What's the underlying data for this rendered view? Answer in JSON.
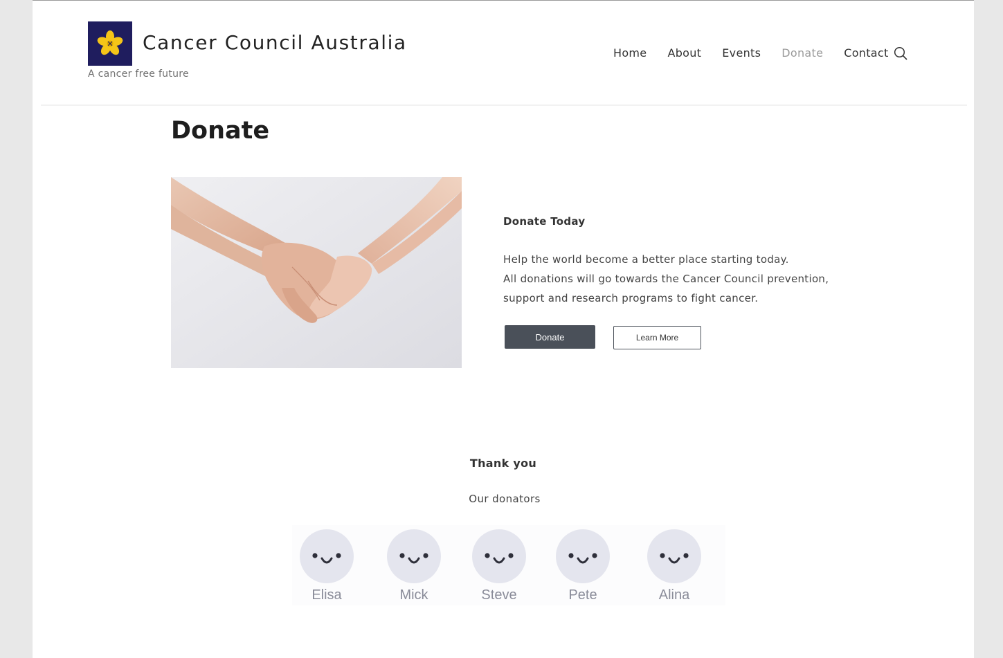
{
  "site": {
    "title": "Cancer Council Australia",
    "tagline": "A cancer free future",
    "logo_icon": "daffodil-icon",
    "colors": {
      "logo_bg": "#1f1d5e",
      "logo_flower": "#f5c518",
      "button_dark": "#4a5059"
    }
  },
  "nav": {
    "items": [
      {
        "label": "Home",
        "active": false
      },
      {
        "label": "About",
        "active": false
      },
      {
        "label": "Events",
        "active": false
      },
      {
        "label": "Donate",
        "active": true
      },
      {
        "label": "Contact",
        "active": false
      }
    ],
    "search_icon": "search-icon"
  },
  "page": {
    "title": "Donate"
  },
  "donate_section": {
    "heading": "Donate Today",
    "lines": [
      "Help the world become a better place starting today.",
      "All donations will go towards the Cancer Council prevention,",
      "support and research programs to fight cancer."
    ],
    "donate_button": "Donate",
    "learn_more_button": "Learn More"
  },
  "thanks_section": {
    "heading": "Thank you",
    "subheading": "Our donators",
    "donors": [
      {
        "name": "Elisa"
      },
      {
        "name": "Mick"
      },
      {
        "name": "Steve"
      },
      {
        "name": "Pete"
      },
      {
        "name": "Alina"
      }
    ]
  }
}
